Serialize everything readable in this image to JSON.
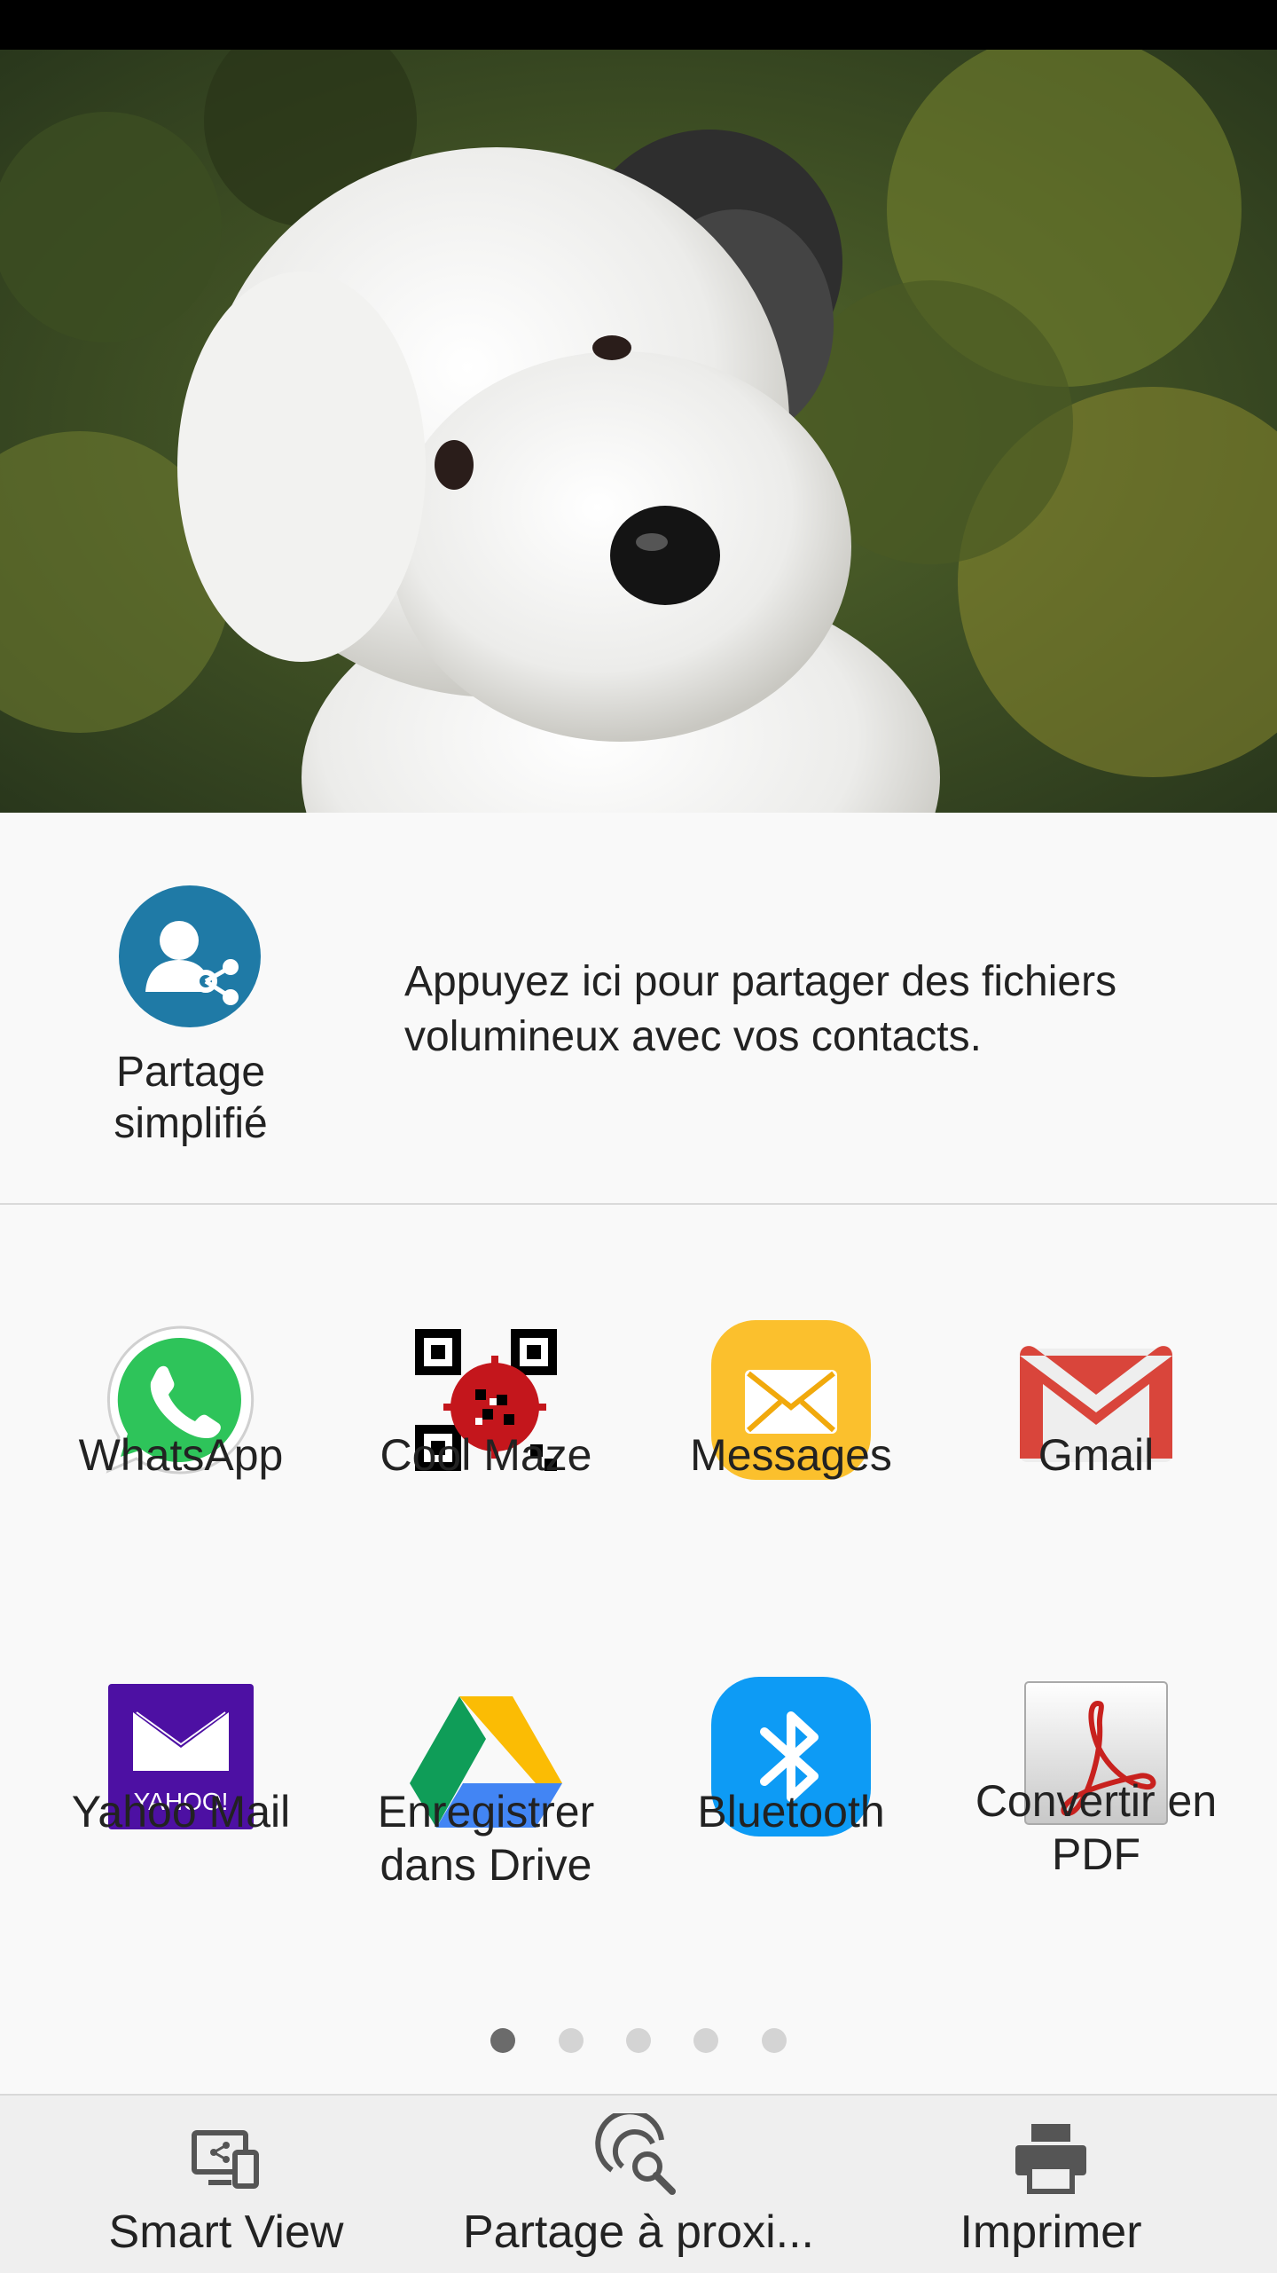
{
  "preview": {
    "image_alt": "dog-photo"
  },
  "simple_share": {
    "label": "Partage simplifié",
    "description": "Appuyez ici pour partager des fichiers volumineux avec vos contacts."
  },
  "apps": [
    {
      "label": "WhatsApp",
      "icon": "whatsapp-icon"
    },
    {
      "label": "Cool Maze",
      "icon": "cool-maze-icon"
    },
    {
      "label": "Messages",
      "icon": "messages-icon"
    },
    {
      "label": "Gmail",
      "icon": "gmail-icon"
    },
    {
      "label": "Yahoo Mail",
      "icon": "yahoo-mail-icon"
    },
    {
      "label": "Enregistrer dans Drive",
      "icon": "google-drive-icon"
    },
    {
      "label": "Bluetooth",
      "icon": "bluetooth-icon"
    },
    {
      "label": "Convertir en PDF",
      "icon": "pdf-icon"
    }
  ],
  "yahoo_logo_text": "YAHOO!",
  "pagination": {
    "pages": 5,
    "current": 1
  },
  "bottom_bar": {
    "smart_view": "Smart View",
    "nearby_share": "Partage à proxi...",
    "print": "Imprimer"
  },
  "colors": {
    "simple_share_icon": "#1f7aa6",
    "whatsapp": "#2ec45a",
    "messages": "#fbc02d",
    "gmail": "#d9453b",
    "yahoo": "#4d10a3",
    "bluetooth": "#0d9bf5",
    "pdf": "#c8211e"
  }
}
